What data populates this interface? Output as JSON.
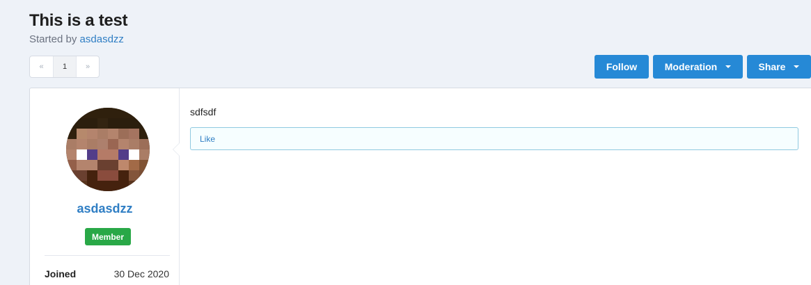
{
  "thread": {
    "title": "This is a test",
    "started_by_prefix": "Started by",
    "author": "asdasdzz"
  },
  "pager": {
    "prev": "«",
    "current_page": "1",
    "next": "»"
  },
  "actions": {
    "follow": "Follow",
    "moderation": "Moderation",
    "share": "Share"
  },
  "post": {
    "username": "asdasdzz",
    "role": "Member",
    "joined_label": "Joined",
    "joined_value": "30 Dec 2020",
    "content": "sdfsdf",
    "like_label": "Like"
  },
  "colors": {
    "accent": "#2689d6",
    "link": "#2f7ec4",
    "badge_member": "#29a847",
    "background": "#eef2f8"
  }
}
